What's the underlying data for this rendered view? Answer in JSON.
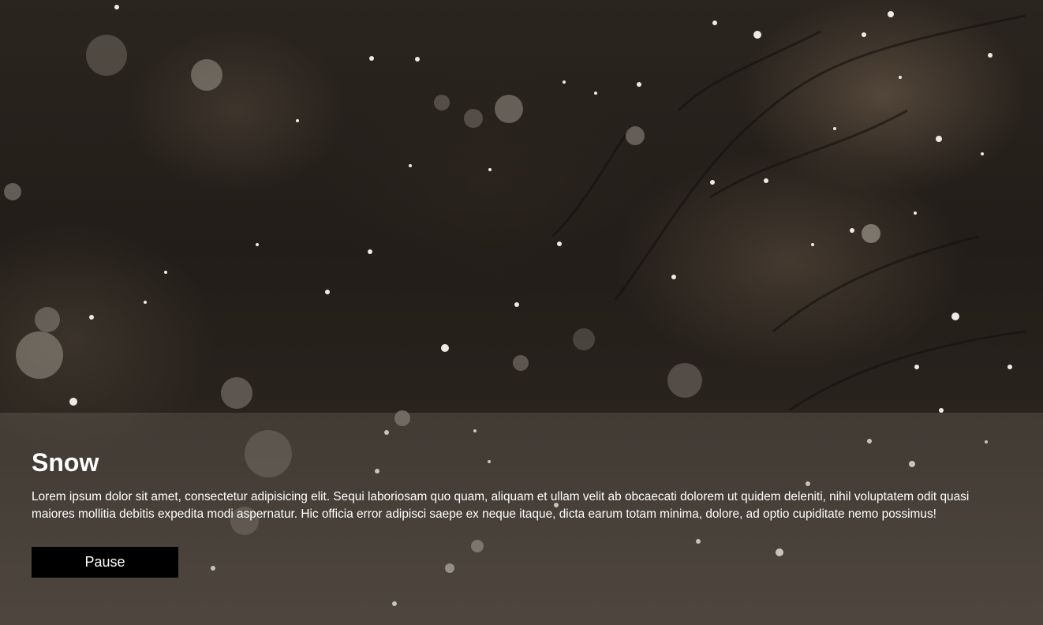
{
  "caption": {
    "title": "Snow",
    "text": "Lorem ipsum dolor sit amet, consectetur adipisicing elit. Sequi laboriosam quo quam, aliquam et ullam velit ab obcaecati dolorem ut quidem deleniti, nihil voluptatem odit quasi maiores mollitia debitis expedita modi aspernatur. Hic officia error adipisci saepe ex neque itaque, dicta earum totam minima, dolore, ad optio cupiditate nemo possimus!",
    "button_label": "Pause"
  },
  "colors": {
    "overlay": "#787068",
    "button_bg": "#000000",
    "text": "#ffffff"
  }
}
